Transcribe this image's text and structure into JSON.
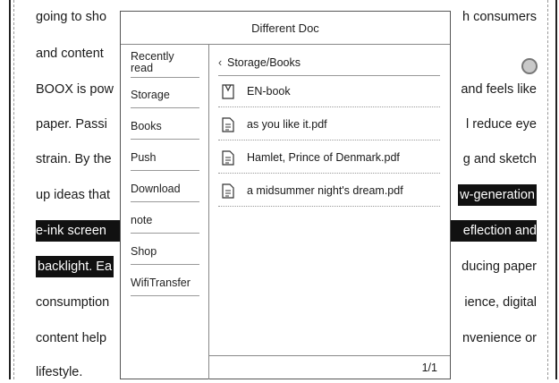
{
  "background_text": {
    "lines": [
      {
        "left": "going to sho",
        "right": "h consumers",
        "style": "plain"
      },
      {
        "left": "and content",
        "right": "",
        "style": "plain"
      },
      {
        "left": "BOOX is pow",
        "right": "and feels like",
        "style": "plain"
      },
      {
        "left": "paper. Passi",
        "right": "l  reduce  eye",
        "style": "plain"
      },
      {
        "left": "strain. By the",
        "right": "g and sketch",
        "style": "plain"
      },
      {
        "left": "up ideas that",
        "right": "w-generation",
        "style": "right-highlight"
      },
      {
        "left": "e-ink  screen",
        "right": "eflection   and",
        "style": "full-highlight"
      },
      {
        "left": "backlight. Ea",
        "right": "ducing paper",
        "style": "left-highlight"
      },
      {
        "left": "consumption",
        "right": "ience, digital",
        "style": "plain"
      },
      {
        "left": "content  help",
        "right": "nvenience  or",
        "style": "plain"
      },
      {
        "left": "lifestyle.",
        "right": "",
        "style": "plain"
      }
    ]
  },
  "dialog": {
    "title": "Different Doc",
    "sidebar": [
      "Recently read",
      "Storage",
      "Books",
      "Push",
      "Download",
      "note",
      "Shop",
      "WifiTransfer"
    ],
    "breadcrumb": "Storage/Books",
    "files": [
      {
        "name": "EN-book",
        "icon": "book-folder-icon"
      },
      {
        "name": "as you like it.pdf",
        "icon": "document-icon"
      },
      {
        "name": "Hamlet, Prince of Denmark.pdf",
        "icon": "document-icon"
      },
      {
        "name": "a midsummer night's dream.pdf",
        "icon": "document-icon"
      }
    ],
    "page_indicator": "1/1"
  },
  "colors": {
    "highlight": "#111111",
    "border": "#555555",
    "scroll_dot": "#c9c9c9"
  }
}
